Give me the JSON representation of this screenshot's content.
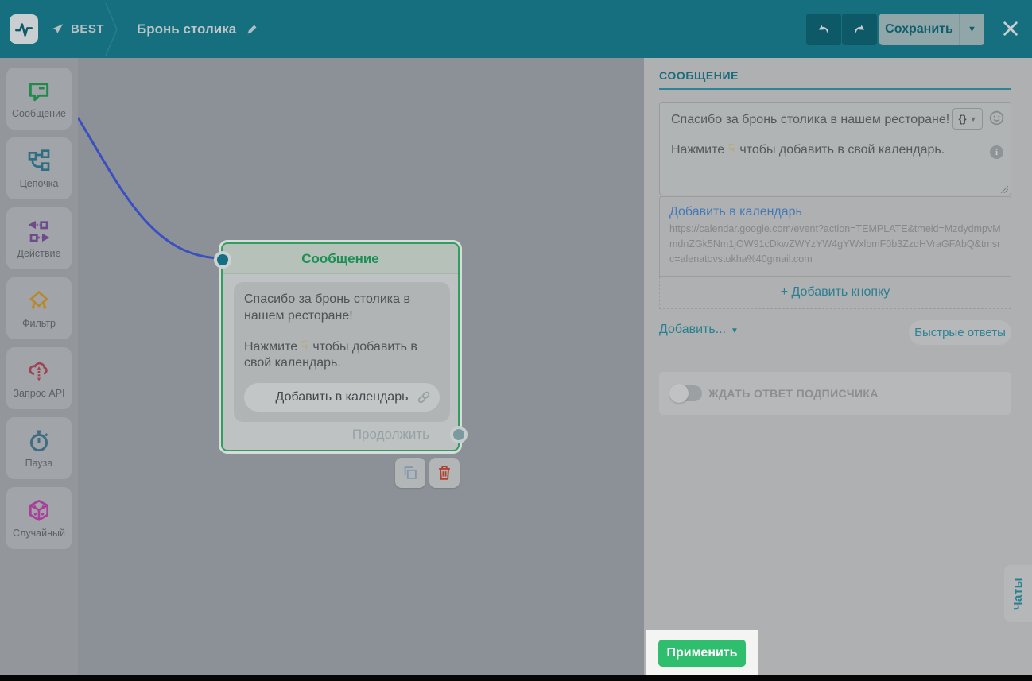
{
  "topbar": {
    "back_label": "BEST",
    "title": "Бронь столика",
    "save_label": "Сохранить"
  },
  "sidebar": {
    "items": [
      {
        "label": "Сообщение",
        "icon": "message-icon"
      },
      {
        "label": "Цепочка",
        "icon": "chain-icon"
      },
      {
        "label": "Действие",
        "icon": "action-icon"
      },
      {
        "label": "Фильтр",
        "icon": "filter-icon"
      },
      {
        "label": "Запрос API",
        "icon": "api-icon"
      },
      {
        "label": "Пауза",
        "icon": "pause-icon"
      },
      {
        "label": "Случайный",
        "icon": "random-icon"
      }
    ]
  },
  "node": {
    "title": "Сообщение",
    "msg1": "Спасибо за бронь столика в нашем ресторане!",
    "msg2_pre": "Нажмите",
    "hand": "☟",
    "msg2_post": "чтобы добавить в свой календарь.",
    "button_label": "Добавить в календарь",
    "continue_label": "Продолжить"
  },
  "panel": {
    "header": "СООБЩЕНИЕ",
    "msg1": "Спасибо за бронь столика в нашем ресторане!",
    "msg2_pre": "Нажмите",
    "hand": "☟",
    "msg2_post": "чтобы добавить в свой календарь.",
    "variable_label": "{}",
    "button_link": "Добавить в календарь",
    "button_url": "https://calendar.google.com/event?action=TEMPLATE&tmeid=MzdydmpvMmdnZGk5Nm1jOW91cDkwZWYzYW4gYWxlbmF0b3ZzdHVraGFAbQ&tmsrc=alenatovstukha%40gmail.com",
    "add_button_label": "+ Добавить кнопку",
    "add_more_label": "Добавить...",
    "quick_replies_label": "Быстрые ответы",
    "wait_label": "ЖДАТЬ ОТВЕТ ПОДПИСЧИКА",
    "apply_label": "Применить"
  },
  "chats_tab": {
    "label": "Чаты"
  },
  "accents": {
    "topbar_bg": "#156f7e",
    "node_selection_green": "#2f9e5f",
    "apply_green": "#2fbe6e",
    "link_blue": "#4479b8",
    "panel_teal": "#27808f",
    "connector_blue": "#3a4fc1",
    "message_icon": "#1f8a4c",
    "chain_icon": "#2d6e85",
    "action_icon": "#6f4a8c",
    "filter_icon": "#b8892a",
    "api_icon": "#9e4450",
    "pause_icon": "#3f6c82",
    "random_icon": "#a83f9a",
    "delete_red": "#b0402f"
  }
}
